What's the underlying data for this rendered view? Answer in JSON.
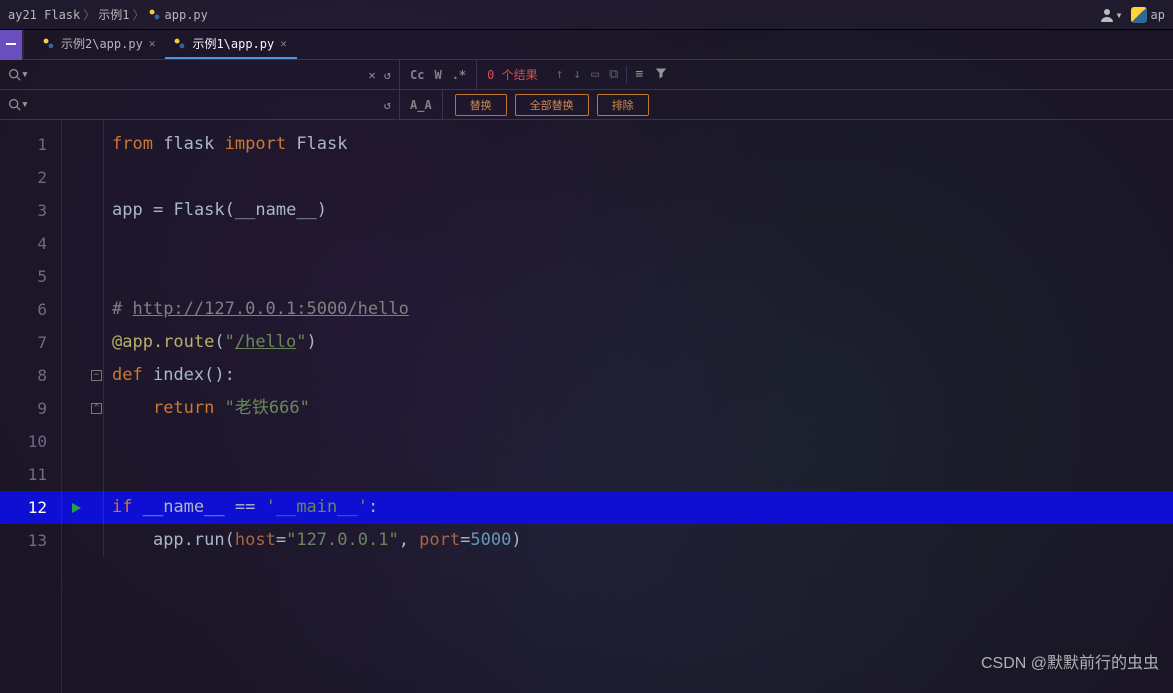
{
  "breadcrumb": {
    "items": [
      "ay21 Flask",
      "示例1",
      "app.py"
    ]
  },
  "tabs": [
    {
      "label": "示例2\\app.py",
      "active": false,
      "icon": "python-file-icon"
    },
    {
      "label": "示例1\\app.py",
      "active": true,
      "icon": "python-file-icon"
    }
  ],
  "find": {
    "value": "",
    "opts": {
      "case": "Cc",
      "words": "W",
      "regex": ".*"
    },
    "result_text": "0 个结果",
    "aa_label": "A̲A"
  },
  "replace": {
    "btn_replace": "替换",
    "btn_replace_all": "全部替换",
    "btn_exclude": "排除"
  },
  "code": {
    "lines": [
      {
        "n": 1,
        "tokens": [
          [
            "kw",
            "from"
          ],
          [
            "sp",
            " "
          ],
          [
            "id",
            "flask"
          ],
          [
            "sp",
            " "
          ],
          [
            "kw",
            "import"
          ],
          [
            "sp",
            " "
          ],
          [
            "cls",
            "Flask"
          ]
        ]
      },
      {
        "n": 2,
        "tokens": []
      },
      {
        "n": 3,
        "tokens": [
          [
            "id",
            "app"
          ],
          [
            "sp",
            " "
          ],
          [
            "op",
            "="
          ],
          [
            "sp",
            " "
          ],
          [
            "cls",
            "Flask"
          ],
          [
            "pn",
            "("
          ],
          [
            "id",
            "__name__"
          ],
          [
            "pn",
            ")"
          ]
        ]
      },
      {
        "n": 4,
        "tokens": []
      },
      {
        "n": 5,
        "tokens": []
      },
      {
        "n": 6,
        "tokens": [
          [
            "cmt",
            "# "
          ],
          [
            "cmtlnk",
            "http://127.0.0.1:5000/hello"
          ]
        ]
      },
      {
        "n": 7,
        "tokens": [
          [
            "dec",
            "@app.route"
          ],
          [
            "pn",
            "("
          ],
          [
            "str",
            "\""
          ],
          [
            "strlnk",
            "/hello"
          ],
          [
            "str",
            "\""
          ],
          [
            "pn",
            ")"
          ]
        ]
      },
      {
        "n": 8,
        "tokens": [
          [
            "kw",
            "def"
          ],
          [
            "sp",
            " "
          ],
          [
            "id",
            "index"
          ],
          [
            "pn",
            "():"
          ]
        ],
        "fold": "start"
      },
      {
        "n": 9,
        "tokens": [
          [
            "sp",
            "    "
          ],
          [
            "kw",
            "return"
          ],
          [
            "sp",
            " "
          ],
          [
            "str",
            "\"老铁666\""
          ]
        ],
        "fold": "end"
      },
      {
        "n": 10,
        "tokens": []
      },
      {
        "n": 11,
        "tokens": []
      },
      {
        "n": 12,
        "tokens": [
          [
            "kw",
            "if"
          ],
          [
            "sp",
            " "
          ],
          [
            "id",
            "__name__"
          ],
          [
            "sp",
            " "
          ],
          [
            "op",
            "=="
          ],
          [
            "sp",
            " "
          ],
          [
            "str",
            "'__main__'"
          ],
          [
            "pn",
            ":"
          ]
        ],
        "current": true,
        "play": true
      },
      {
        "n": 13,
        "tokens": [
          [
            "sp",
            "    "
          ],
          [
            "id",
            "app"
          ],
          [
            "pn",
            "."
          ],
          [
            "id",
            "run"
          ],
          [
            "pn",
            "("
          ],
          [
            "param",
            "host"
          ],
          [
            "op",
            "="
          ],
          [
            "str",
            "\"127.0.0.1\""
          ],
          [
            "pn",
            ", "
          ],
          [
            "param",
            "port"
          ],
          [
            "op",
            "="
          ],
          [
            "num",
            "5000"
          ],
          [
            "pn",
            ")"
          ]
        ]
      }
    ]
  },
  "watermark": "CSDN @默默前行的虫虫"
}
